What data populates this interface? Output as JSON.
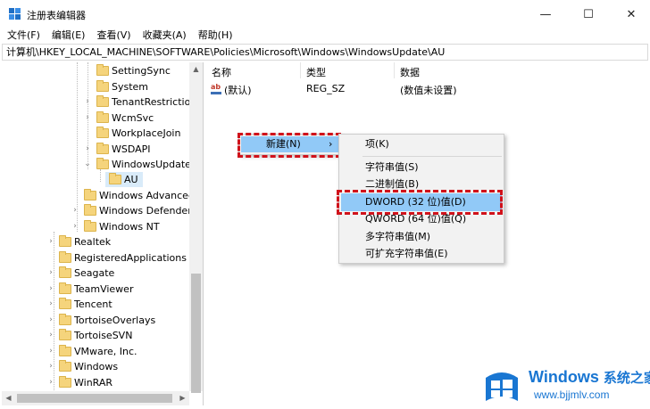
{
  "window": {
    "title": "注册表编辑器",
    "controls": {
      "minimize": "—",
      "maximize": "☐",
      "close": "✕"
    }
  },
  "menu": [
    "文件(F)",
    "编辑(E)",
    "查看(V)",
    "收藏夹(A)",
    "帮助(H)"
  ],
  "address": "计算机\\HKEY_LOCAL_MACHINE\\SOFTWARE\\Policies\\Microsoft\\Windows\\WindowsUpdate\\AU",
  "tree": [
    {
      "label": "SettingSync",
      "expander": ""
    },
    {
      "label": "System",
      "expander": ""
    },
    {
      "label": "TenantRestrictions",
      "expander": "›"
    },
    {
      "label": "WcmSvc",
      "expander": "›"
    },
    {
      "label": "WorkplaceJoin",
      "expander": ""
    },
    {
      "label": "WSDAPI",
      "expander": "›"
    },
    {
      "label": "WindowsUpdate",
      "expander": "⌄"
    },
    {
      "label": "AU",
      "expander": ""
    },
    {
      "label": "Windows Advanced",
      "expander": ""
    },
    {
      "label": "Windows Defender",
      "expander": "›"
    },
    {
      "label": "Windows NT",
      "expander": "›"
    },
    {
      "label": "Realtek",
      "expander": "›"
    },
    {
      "label": "RegisteredApplications",
      "expander": ""
    },
    {
      "label": "Seagate",
      "expander": "›"
    },
    {
      "label": "TeamViewer",
      "expander": "›"
    },
    {
      "label": "Tencent",
      "expander": "›"
    },
    {
      "label": "TortoiseOverlays",
      "expander": "›"
    },
    {
      "label": "TortoiseSVN",
      "expander": "›"
    },
    {
      "label": "VMware, Inc.",
      "expander": "›"
    },
    {
      "label": "Windows",
      "expander": "›"
    },
    {
      "label": "WinRAR",
      "expander": "›"
    }
  ],
  "columns": {
    "name": "名称",
    "type": "类型",
    "data": "数据"
  },
  "values": [
    {
      "name": "(默认)",
      "type": "REG_SZ",
      "data": "(数值未设置)"
    }
  ],
  "context_menu": {
    "new_label": "新建(N)",
    "arrow": "›",
    "submenu": {
      "key": "项(K)",
      "items": [
        "字符串值(S)",
        "二进制值(B)",
        "DWORD (32 位)值(D)",
        "QWORD (64 位)值(Q)",
        "多字符串值(M)",
        "可扩充字符串值(E)"
      ]
    }
  },
  "watermark": {
    "brand": "Windows",
    "brand_cn": "系统之家",
    "url": "www.bjjmlv.com"
  },
  "colors": {
    "highlight_red": "#d0121b",
    "menu_hover": "#91c9f7",
    "folder": "#f5d47c",
    "watermark_blue": "#1976d2"
  }
}
